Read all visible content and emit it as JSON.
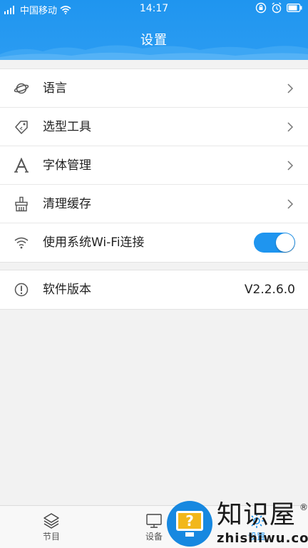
{
  "status_bar": {
    "carrier": "中国移动",
    "time": "14:17"
  },
  "header": {
    "title": "设置"
  },
  "settings": {
    "items": [
      {
        "label": "语言",
        "icon": "planet-icon"
      },
      {
        "label": "选型工具",
        "icon": "tag-icon"
      },
      {
        "label": "字体管理",
        "icon": "font-icon"
      },
      {
        "label": "清理缓存",
        "icon": "broom-icon"
      },
      {
        "label": "使用系统Wi-Fi连接",
        "icon": "wifi-icon",
        "toggle_on": true
      }
    ],
    "version": {
      "label": "软件版本",
      "value": "V2.2.6.0",
      "icon": "info-icon"
    }
  },
  "bottom_nav": {
    "items": [
      {
        "label": "节目",
        "icon": "layers-icon"
      },
      {
        "label": "设备",
        "icon": "monitor-icon"
      },
      {
        "label": "设置",
        "icon": "settings-icon",
        "active": true
      }
    ]
  },
  "watermark": {
    "title": "知识屋",
    "url": "zhishiwu.com",
    "reg": "®"
  },
  "colors": {
    "accent": "#1f95ef",
    "background": "#f2f2f2"
  }
}
